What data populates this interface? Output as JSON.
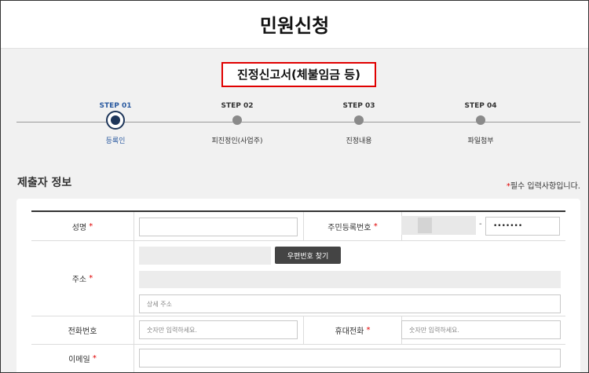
{
  "page": {
    "title": "민원신청"
  },
  "form": {
    "title": "진정신고서(체불임금 등)"
  },
  "steps": [
    {
      "num": "STEP 01",
      "name": "등록인",
      "active": true
    },
    {
      "num": "STEP 02",
      "name": "피진정인(사업주)",
      "active": false
    },
    {
      "num": "STEP 03",
      "name": "진정내용",
      "active": false
    },
    {
      "num": "STEP 04",
      "name": "파일첨부",
      "active": false
    }
  ],
  "section": {
    "title": "제출자 정보",
    "required_mark": "*",
    "required_note": "필수 입력사항입니다."
  },
  "fields": {
    "name": {
      "label": "성명",
      "value": ""
    },
    "rrn": {
      "label": "주민등록번호",
      "separator": "-",
      "masked_value": "•••••••"
    },
    "address": {
      "label": "주소",
      "postcode_button": "우편번호 찾기",
      "detail_placeholder": "상세 주소"
    },
    "phone": {
      "label": "전화번호",
      "placeholder": "숫자만 입력하세요."
    },
    "mobile": {
      "label": "휴대전화",
      "placeholder": "숫자만 입력하세요."
    },
    "email": {
      "label": "이메일",
      "value": ""
    }
  },
  "colors": {
    "required": "#e00000",
    "step_active": "#1d3559",
    "step_text_active": "#2a5aa0",
    "highlight_border": "#e00000"
  }
}
